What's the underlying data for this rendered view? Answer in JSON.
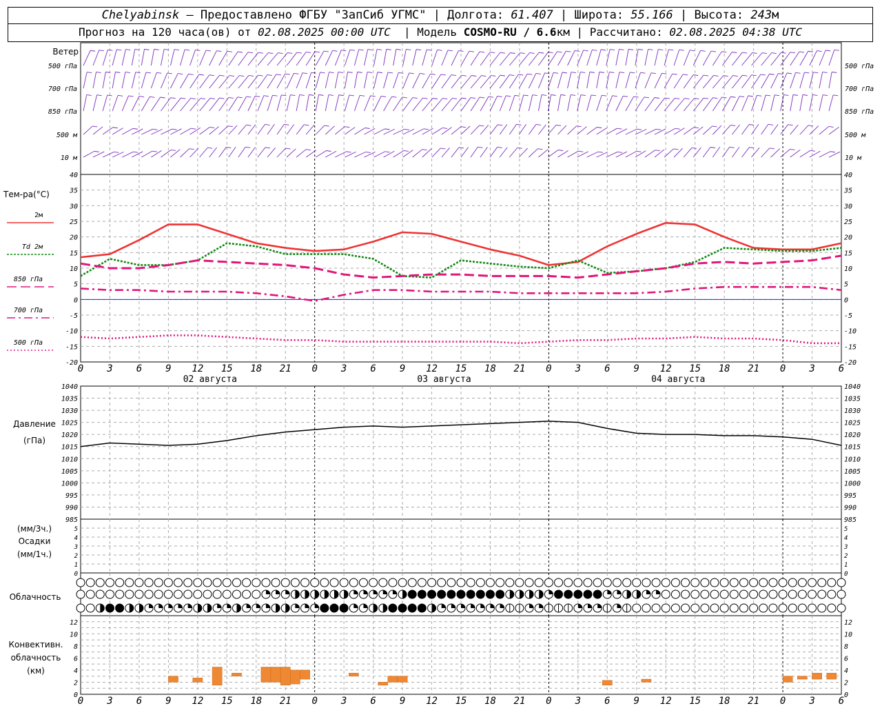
{
  "header": {
    "city": "Chelyabinsk",
    "provider": "— Предоставлено ФГБУ \"ЗапСиб УГМС\"",
    "lon_label": "Долгота:",
    "lon": "61.407",
    "lat_label": "Широта:",
    "lat": "55.166",
    "alt_label": "Высота:",
    "alt": "243",
    "alt_unit": "м",
    "forecast_label": "Прогноз на 120 часа(ов) от",
    "forecast_start": "02.08.2025 00:00 UTC",
    "model_label": "Модель",
    "model": "COSMO-RU / 6.6",
    "model_unit": "км",
    "calc_label": "Рассчитано:",
    "calc_time": "02.08.2025 04:38 UTC"
  },
  "wind_panel": {
    "title": "Ветер",
    "levels": [
      "500 гПа",
      "700 гПа",
      "850 гПа",
      "500 м",
      "10 м"
    ],
    "color": "#7b2cbf"
  },
  "temp_panel": {
    "title": "Тем-ра(°C)",
    "legend": [
      {
        "label": "2м",
        "color": "#ee3333",
        "style": "solid"
      },
      {
        "label": "Td  2м",
        "color": "#118811",
        "style": "dotted"
      },
      {
        "label": "850 гПа",
        "color": "#e0157a",
        "style": "dash"
      },
      {
        "label": "700 гПа",
        "color": "#e0157a",
        "style": "dashdot"
      },
      {
        "label": "500 гПа",
        "color": "#e0157a",
        "style": "dot"
      }
    ],
    "yticks": [
      "40",
      "35",
      "30",
      "25",
      "20",
      "15",
      "10",
      "5",
      "0",
      "-5",
      "-10",
      "-15",
      "-20"
    ],
    "day_labels": [
      "02 августа",
      "03 августа",
      "04 августа"
    ]
  },
  "pressure_panel": {
    "title": "Давление",
    "unit": "(гПа)",
    "yticks": [
      "1040",
      "1035",
      "1030",
      "1025",
      "1020",
      "1015",
      "1010",
      "1005",
      "1000",
      "995",
      "990",
      "985"
    ]
  },
  "precip_panel": {
    "unit1": "(мм/3ч.)",
    "title": "Осадки",
    "unit2": "(мм/1ч.)",
    "yticks": [
      "5",
      "4",
      "3",
      "2",
      "1",
      "0"
    ]
  },
  "cloud_panel": {
    "title": "Облачность"
  },
  "conv_panel": {
    "title1": "Конвективн.",
    "title2": "облачность",
    "unit": "(км)",
    "yticks": [
      "12",
      "10",
      "8",
      "6",
      "4",
      "2",
      "0"
    ],
    "color": "#ee8833"
  },
  "time_axis": {
    "hour_labels": [
      "0",
      "3",
      "6",
      "9",
      "12",
      "15",
      "18",
      "21",
      "0",
      "3",
      "6",
      "9",
      "12",
      "15",
      "18",
      "21",
      "0",
      "3",
      "6",
      "9",
      "12",
      "15",
      "18",
      "21",
      "0",
      "3",
      "6"
    ]
  },
  "chart_data": {
    "type": "line",
    "x_hours": [
      0,
      3,
      6,
      9,
      12,
      15,
      18,
      21,
      24,
      27,
      30,
      33,
      36,
      39,
      42,
      45,
      48,
      51,
      54,
      57,
      60,
      63,
      66,
      69,
      72,
      75,
      78
    ],
    "series": [
      {
        "name": "2м",
        "values": [
          13.5,
          14.5,
          19,
          24,
          24,
          21,
          18,
          16.5,
          15.5,
          16,
          18.5,
          21.5,
          21,
          18.5,
          16,
          14,
          11,
          12,
          17,
          21,
          24.5,
          24,
          20,
          16.5,
          16,
          16,
          18
        ]
      },
      {
        "name": "Td  2м",
        "values": [
          7.5,
          13,
          11,
          11,
          12.5,
          18,
          17,
          14.5,
          14.5,
          14.5,
          13,
          7.5,
          7,
          12.5,
          11.5,
          10.5,
          10,
          12.5,
          8.5,
          9,
          10,
          12,
          16.5,
          16,
          15.5,
          15.5,
          16.5
        ]
      },
      {
        "name": "850 гПа",
        "values": [
          11.5,
          10,
          10,
          11,
          12.5,
          12,
          11.5,
          11,
          10,
          8,
          7,
          7.5,
          8,
          8,
          7.5,
          7.5,
          7.5,
          7,
          8,
          9,
          10,
          11.5,
          12,
          11.5,
          12,
          12.5,
          14
        ]
      },
      {
        "name": "700 гПа",
        "values": [
          3.5,
          3,
          3,
          2.5,
          2.5,
          2.5,
          2,
          1,
          -0.5,
          1.5,
          3,
          3,
          2.5,
          2.5,
          2.5,
          2,
          2,
          2,
          2,
          2,
          2.5,
          3.5,
          4,
          4,
          4,
          4,
          3
        ]
      },
      {
        "name": "500 гПа",
        "values": [
          -12,
          -12.5,
          -12,
          -11.5,
          -11.5,
          -12,
          -12.5,
          -13,
          -13,
          -13.5,
          -13.5,
          -13.5,
          -13.5,
          -13.5,
          -13.5,
          -14,
          -13.5,
          -13,
          -13,
          -12.5,
          -12.5,
          -12,
          -12.5,
          -12.5,
          -13,
          -14,
          -14
        ]
      },
      {
        "name": "Давление",
        "values": [
          1015,
          1016.5,
          1016,
          1015.5,
          1016,
          1017.5,
          1019.5,
          1021,
          1022,
          1023,
          1023.5,
          1023,
          1023.5,
          1024,
          1024.5,
          1025,
          1025.5,
          1025,
          1022.5,
          1020.5,
          1020,
          1020,
          1019.5,
          1019.5,
          1019,
          1018,
          1015.5
        ]
      }
    ],
    "temp_ylim": [
      -20,
      40
    ],
    "pressure_ylim": [
      985,
      1040
    ],
    "precip_ylim": [
      0,
      5
    ],
    "precip_values": [
      0,
      0,
      0,
      0,
      0,
      0,
      0,
      0,
      0,
      0,
      0,
      0,
      0,
      0,
      0,
      0,
      0,
      0,
      0,
      0,
      0,
      0,
      0,
      0,
      0,
      0,
      0
    ],
    "conv_ylim": [
      0,
      13
    ],
    "convective_cloud_km": [
      {
        "hour": 9.5,
        "base": 2,
        "top": 3
      },
      {
        "hour": 12,
        "base": 2,
        "top": 2.7
      },
      {
        "hour": 14,
        "base": 1.5,
        "top": 4.5
      },
      {
        "hour": 16,
        "base": 3,
        "top": 3.5
      },
      {
        "hour": 19,
        "base": 2,
        "top": 4.5
      },
      {
        "hour": 20,
        "base": 2,
        "top": 4.5
      },
      {
        "hour": 21,
        "base": 1.5,
        "top": 4.5
      },
      {
        "hour": 22,
        "base": 1.7,
        "top": 4
      },
      {
        "hour": 23,
        "base": 2.5,
        "top": 4
      },
      {
        "hour": 28,
        "base": 3,
        "top": 3.5
      },
      {
        "hour": 31,
        "base": 1.5,
        "top": 2
      },
      {
        "hour": 32,
        "base": 2,
        "top": 3
      },
      {
        "hour": 33,
        "base": 2,
        "top": 3
      },
      {
        "hour": 54,
        "base": 1.5,
        "top": 2.3
      },
      {
        "hour": 58,
        "base": 2,
        "top": 2.5
      },
      {
        "hour": 72.5,
        "base": 2,
        "top": 3
      },
      {
        "hour": 74,
        "base": 2.5,
        "top": 3
      },
      {
        "hour": 75.5,
        "base": 2.5,
        "top": 3.5
      },
      {
        "hour": 77,
        "base": 2.5,
        "top": 3.5
      }
    ],
    "cloud_cover": {
      "rows": [
        "high",
        "middle",
        "low"
      ],
      "high": [
        0,
        0,
        0,
        0,
        0,
        0,
        0,
        0,
        0,
        0,
        0,
        0,
        0,
        0,
        0,
        0,
        0,
        0,
        0,
        0,
        0,
        0,
        0,
        0,
        0,
        0,
        0,
        0,
        0,
        0,
        0,
        0,
        0,
        0,
        0,
        0,
        0,
        0,
        0,
        0,
        0,
        0,
        0,
        0,
        0,
        0,
        0,
        0,
        0,
        0,
        0,
        0,
        0,
        0,
        0,
        0,
        0,
        0,
        0,
        0,
        0,
        0,
        0,
        0,
        0,
        0,
        0,
        0,
        0,
        0,
        0,
        0,
        0,
        0,
        0,
        0,
        0,
        0,
        0
      ],
      "middle": [
        0,
        0,
        0,
        0,
        0,
        0,
        0,
        0,
        0,
        0,
        0,
        0,
        0,
        0,
        0,
        0,
        0,
        0,
        0,
        2,
        2,
        2,
        3,
        3,
        3,
        3,
        3,
        3,
        2,
        2,
        2,
        2,
        2,
        3,
        4,
        4,
        4,
        4,
        4,
        4,
        4,
        4,
        4,
        4,
        3,
        3,
        3,
        3,
        2,
        4,
        4,
        4,
        4,
        4,
        2,
        2,
        3,
        3,
        2,
        2,
        0,
        0,
        0,
        0,
        0,
        0,
        0,
        0,
        0,
        0,
        0,
        0,
        0,
        0,
        0,
        0,
        0,
        0,
        0
      ],
      "low": [
        0,
        0,
        3,
        4,
        4,
        3,
        3,
        2,
        2,
        2,
        2,
        2,
        3,
        3,
        2,
        2,
        3,
        2,
        2,
        2,
        3,
        3,
        2,
        2,
        2,
        4,
        4,
        4,
        2,
        2,
        3,
        3,
        4,
        4,
        4,
        4,
        3,
        2,
        2,
        2,
        2,
        2,
        2,
        2,
        1,
        1,
        2,
        2,
        1,
        1,
        1,
        2,
        2,
        2,
        1,
        2,
        1,
        0,
        0,
        0,
        0,
        0,
        0,
        0,
        0,
        0,
        0,
        0,
        0,
        0,
        0,
        0,
        0,
        0,
        0,
        0,
        0,
        0,
        0
      ]
    }
  }
}
